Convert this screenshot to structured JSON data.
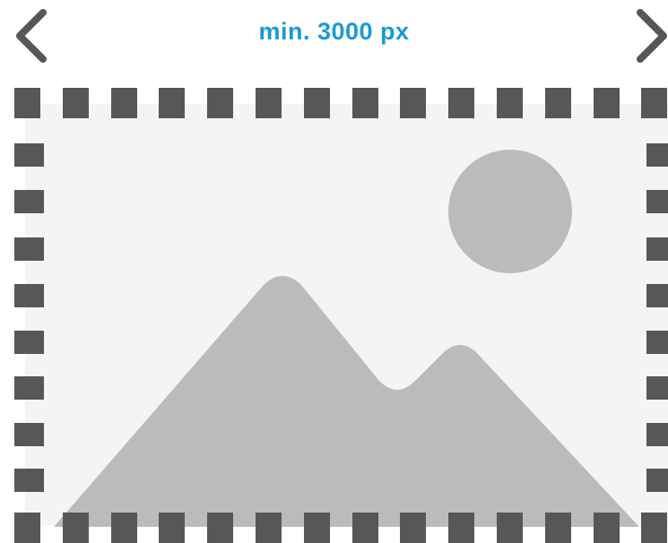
{
  "header": {
    "dimension_label": "min. 3000 px",
    "left_arrow_icon": "chevron-left-icon",
    "right_arrow_icon": "chevron-right-icon"
  },
  "colors": {
    "label": "#1a9ad6",
    "arrow": "#575757",
    "frame_dashes": "#575757",
    "canvas": "#f4f4f4",
    "placeholder_art": "#bbbbbb"
  },
  "placeholder": {
    "icon": "image-placeholder-icon",
    "elements": [
      "sun-icon",
      "mountain-icon"
    ]
  }
}
